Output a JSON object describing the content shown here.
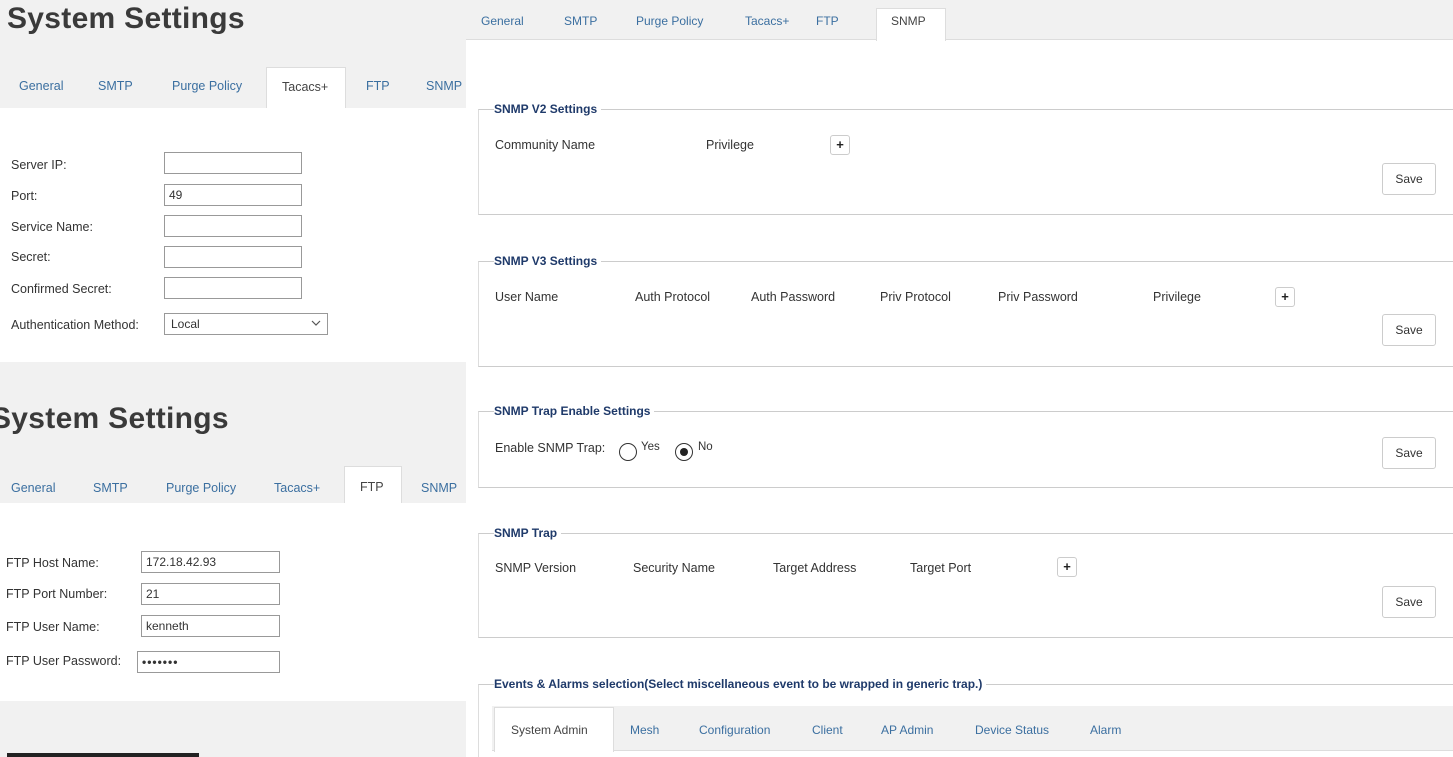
{
  "left_top": {
    "title": "System Settings",
    "tabs": [
      "General",
      "SMTP",
      "Purge Policy",
      "Tacacs+",
      "FTP",
      "SNMP"
    ],
    "active_tab": "Tacacs+",
    "fields": [
      {
        "label": "Server IP:",
        "value": ""
      },
      {
        "label": "Port:",
        "value": "49"
      },
      {
        "label": "Service Name:",
        "value": ""
      },
      {
        "label": "Secret:",
        "value": ""
      },
      {
        "label": "Confirmed Secret:",
        "value": ""
      }
    ],
    "auth_method": {
      "label": "Authentication Method:",
      "value": "Local"
    }
  },
  "left_bottom": {
    "title": "System Settings",
    "tabs": [
      "General",
      "SMTP",
      "Purge Policy",
      "Tacacs+",
      "FTP",
      "SNMP"
    ],
    "active_tab": "FTP",
    "fields": [
      {
        "label": "FTP Host Name:",
        "value": "172.18.42.93"
      },
      {
        "label": "FTP Port Number:",
        "value": "21"
      },
      {
        "label": "FTP User Name:",
        "value": "kenneth"
      },
      {
        "label": "FTP User Password:",
        "value": "•••••••"
      }
    ]
  },
  "right": {
    "tabs": [
      "General",
      "SMTP",
      "Purge Policy",
      "Tacacs+",
      "FTP",
      "SNMP"
    ],
    "active_tab": "SNMP",
    "save_label": "Save",
    "add_label": "+",
    "snmp_v2": {
      "legend": "SNMP V2 Settings",
      "columns": [
        "Community Name",
        "Privilege"
      ]
    },
    "snmp_v3": {
      "legend": "SNMP V3 Settings",
      "columns": [
        "User Name",
        "Auth Protocol",
        "Auth Password",
        "Priv Protocol",
        "Priv Password",
        "Privilege"
      ]
    },
    "trap_enable": {
      "legend": "SNMP Trap Enable Settings",
      "label": "Enable SNMP Trap:",
      "options": [
        "Yes",
        "No"
      ],
      "selected": "No"
    },
    "snmp_trap": {
      "legend": "SNMP Trap",
      "columns": [
        "SNMP Version",
        "Security Name",
        "Target Address",
        "Target Port"
      ]
    },
    "events": {
      "legend": "Events & Alarms selection(Select miscellaneous event to be wrapped in generic trap.)",
      "tabs": [
        "System Admin",
        "Mesh",
        "Configuration",
        "Client",
        "AP Admin",
        "Device Status",
        "Alarm"
      ],
      "active_tab": "System Admin"
    }
  }
}
